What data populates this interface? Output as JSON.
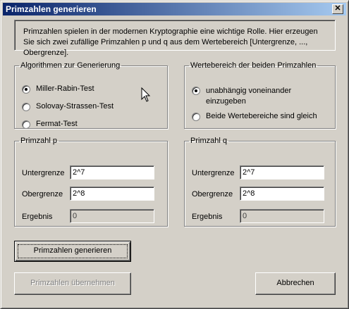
{
  "window": {
    "title": "Primzahlen generieren",
    "close_glyph": "✕"
  },
  "info": {
    "text": "Primzahlen spielen in der modernen Kryptographie eine wichtige Rolle. Hier erzeugen Sie sich zwei zufällige Primzahlen p und q aus dem Wertebereich [Untergrenze, ..., Obergrenze]."
  },
  "algorithms": {
    "legend": "Algorithmen zur Generierung",
    "options": [
      "Miller-Rabin-Test",
      "Solovay-Strassen-Test",
      "Fermat-Test"
    ],
    "selected_index": 0
  },
  "range_mode": {
    "legend": "Wertebereich der beiden Primzahlen",
    "options": [
      "unabhängig voneinander einzugeben",
      "Beide Wertebereiche sind gleich"
    ],
    "selected_index": 0
  },
  "prime_p": {
    "legend": "Primzahl p",
    "lower_label": "Untergrenze",
    "lower_value": "2^7",
    "upper_label": "Obergrenze",
    "upper_value": "2^8",
    "result_label": "Ergebnis",
    "result_value": "0"
  },
  "prime_q": {
    "legend": "Primzahl q",
    "lower_label": "Untergrenze",
    "lower_value": "2^7",
    "upper_label": "Obergrenze",
    "upper_value": "2^8",
    "result_label": "Ergebnis",
    "result_value": "0"
  },
  "buttons": {
    "generate": "Primzahlen generieren",
    "apply": "Primzahlen übernehmen",
    "cancel": "Abbrechen"
  }
}
